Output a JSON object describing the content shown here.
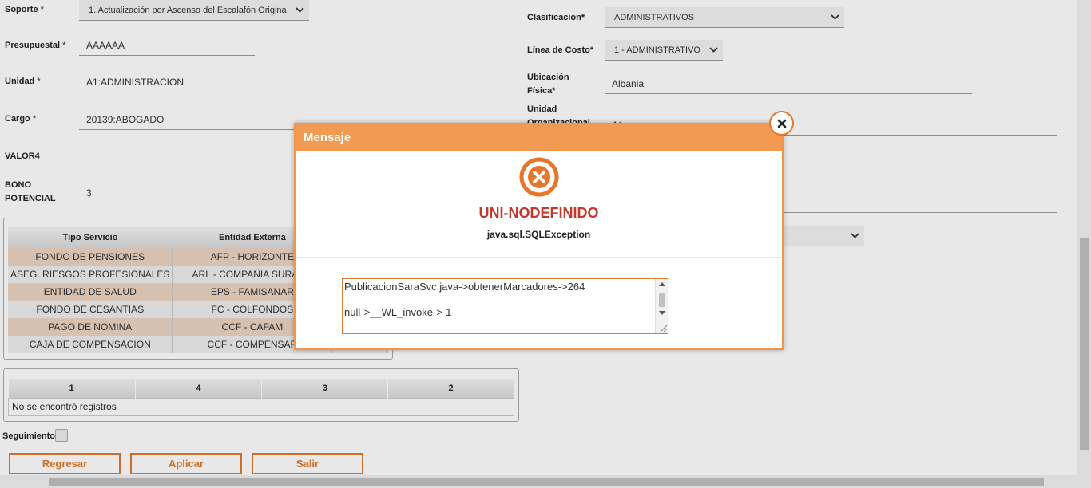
{
  "form": {
    "soporte_label": "Soporte",
    "soporte_value": "1. Actualización por Ascenso del Escalafón Origina",
    "presupuestal_label": "Presupuestal",
    "presupuestal_value": "AAAAAA",
    "unidad_label": "Unidad",
    "unidad_value": "A1:ADMINISTRACION",
    "cargo_label": "Cargo",
    "cargo_value": "20139:ABOGADO",
    "valor4_label": "VALOR4",
    "valor4_value": "",
    "bono_label_1": "BONO",
    "bono_label_2": "POTENCIAL",
    "bono_value": "3",
    "clasificacion_label": "Clasificación*",
    "clasificacion_value": "ADMINISTRATIVOS",
    "linea_costo_label": "Línea de Costo*",
    "linea_costo_value": "1 - ADMINISTRATIVO",
    "ubicacion_label_1": "Ubicación",
    "ubicacion_label_2": "Física*",
    "ubicacion_value": "Albania",
    "unidad_org_label_1": "Unidad",
    "unidad_org_label_2": "Organizacional",
    "unidad_org_value": "A1",
    "required_marker": "*"
  },
  "services_table": {
    "headers": [
      "Tipo Servicio",
      "Entidad Externa"
    ],
    "rows": [
      [
        "FONDO DE PENSIONES",
        "AFP - HORIZONTE"
      ],
      [
        "ASEG. RIESGOS PROFESIONALES",
        "ARL - COMPAÑIA SURAME"
      ],
      [
        "ENTIDAD DE SALUD",
        "EPS - FAMISANAR"
      ],
      [
        "FONDO DE CESANTIAS",
        "FC - COLFONDOS"
      ],
      [
        "PAGO DE NOMINA",
        "CCF - CAFAM"
      ],
      [
        "CAJA DE COMPENSACION",
        "CCF - COMPENSAR"
      ]
    ]
  },
  "markers_table": {
    "headers": [
      "1",
      "4",
      "3",
      "2"
    ],
    "empty_message": "No se encontró registros"
  },
  "seguimiento_label": "Seguimiento",
  "buttons": {
    "regresar": "Regresar",
    "aplicar": "Aplicar",
    "salir": "Salir"
  },
  "dialog": {
    "title": "Mensaje",
    "error_code": "UNI-NODEFINIDO",
    "exception": "java.sql.SQLException",
    "trace_lines": [
      "PublicacionSaraSvc.java->obtenerMarcadores->264",
      "null->__WL_invoke->-1"
    ]
  },
  "colors": {
    "accent": "#e07a2e",
    "dialog_header": "#f29a52",
    "error_title": "#c0392b",
    "row_odd": "#ecd3c1"
  }
}
